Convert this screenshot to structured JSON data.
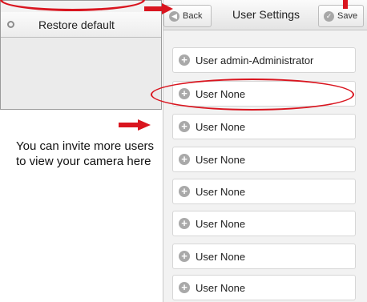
{
  "left_menu": {
    "restore_label": "Restore default"
  },
  "callout": {
    "text": "You can invite more users to view your camera here"
  },
  "header": {
    "back_label": "Back",
    "title": "User Settings",
    "save_label": "Save"
  },
  "users": [
    {
      "label": "User admin-Administrator"
    },
    {
      "label": "User None"
    },
    {
      "label": "User None"
    },
    {
      "label": "User None"
    },
    {
      "label": "User None"
    },
    {
      "label": "User None"
    },
    {
      "label": "User None"
    },
    {
      "label": "User None"
    }
  ],
  "colors": {
    "annotation_red": "#d9151f",
    "icon_gray": "#a9a9a9"
  }
}
